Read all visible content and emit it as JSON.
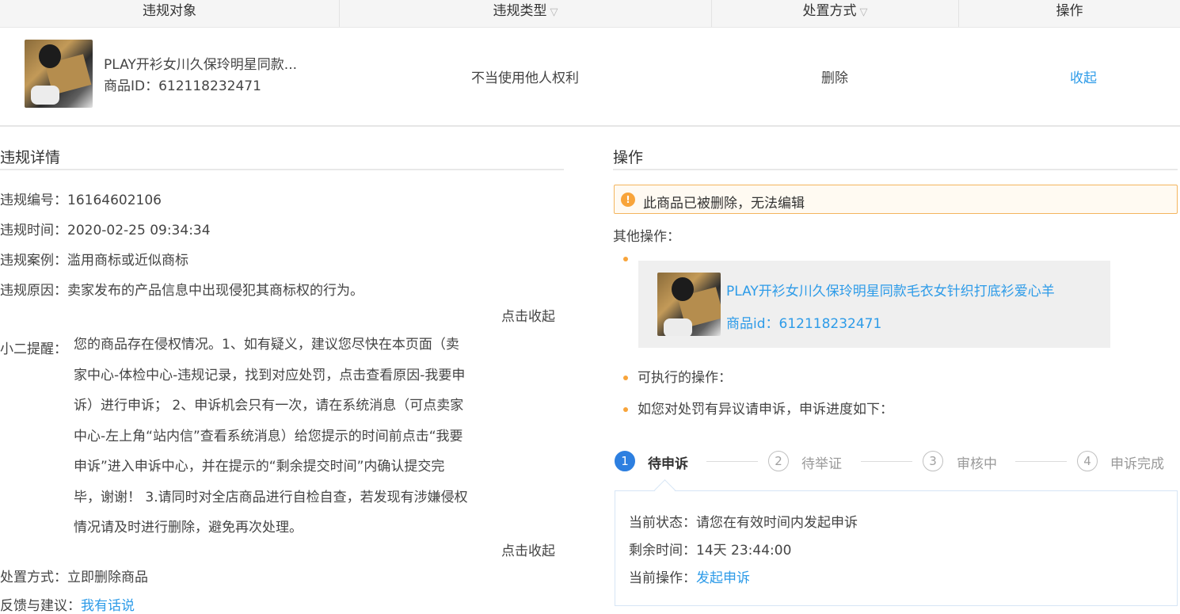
{
  "table": {
    "headers": {
      "object": "违规对象",
      "type": "违规类型",
      "handling": "处置方式",
      "action": "操作"
    },
    "row": {
      "product_name": "PLAY开衫女川久保玲明星同款...",
      "product_id": "商品ID：612118232471",
      "violation_type": "不当使用他人权利",
      "handling": "删除",
      "action": "收起"
    }
  },
  "details": {
    "title": "违规详情",
    "number": "违规编号：16164602106",
    "time": "违规时间：2020-02-25 09:34:34",
    "case": "违规案例：滥用商标或近似商标",
    "reason": "违规原因：卖家发布的产品信息中出现侵犯其商标权的行为。",
    "collapse_1": "点击收起",
    "reminder_label": "小二提醒：",
    "reminder_lines": [
      "您的商品存在侵权情况。1、如有疑义，建议您尽快在本页面（卖",
      "家中心-体检中心-违规记录，找到对应处罚，点击查看原因-我要申",
      "诉）进行申诉； 2、申诉机会只有一次，请在系统消息（可点卖家",
      "中心-左上角“站内信”查看系统消息）给您提示的时间前点击“我要",
      "申诉”进入申诉中心，并在提示的“剩余提交时间”内确认提交完",
      "毕，谢谢！ 3.请同时对全店商品进行自检自查，若发现有涉嫌侵权",
      "情况请及时进行删除，避免再次处理。"
    ],
    "collapse_2": "点击收起",
    "disposal": "处置方式：立即删除商品",
    "feedback_label": "反馈与建议：",
    "feedback_link": "我有话说"
  },
  "operations": {
    "title": "操作",
    "alert_icon": "!",
    "alert": "此商品已被删除，无法编辑",
    "other_ops": "其他操作：",
    "card": {
      "name": "PLAY开衫女川久保玲明星同款毛衣女针织打底衫爱心羊",
      "id": "商品id：612118232471"
    },
    "executable": "可执行的操作：",
    "appeal_intro": "如您对处罚有异议请申诉，申诉进度如下："
  },
  "steps": [
    {
      "num": "1",
      "label": "待申诉"
    },
    {
      "num": "2",
      "label": "待举证"
    },
    {
      "num": "3",
      "label": "审核中"
    },
    {
      "num": "4",
      "label": "申诉完成"
    }
  ],
  "status": {
    "current_state": "当前状态：请您在有效时间内发起申诉",
    "remaining": "剩余时间：14天 23:44:00",
    "current_op_label": "当前操作：",
    "current_op_link": "发起申诉"
  },
  "colors": {
    "link": "#2d9be8",
    "alert_accent": "#f8a43a",
    "step_active": "#2d7fe0"
  },
  "icons": [
    "filter-icon",
    "warning-icon",
    "bullet-dot",
    "product-thumbnail"
  ]
}
